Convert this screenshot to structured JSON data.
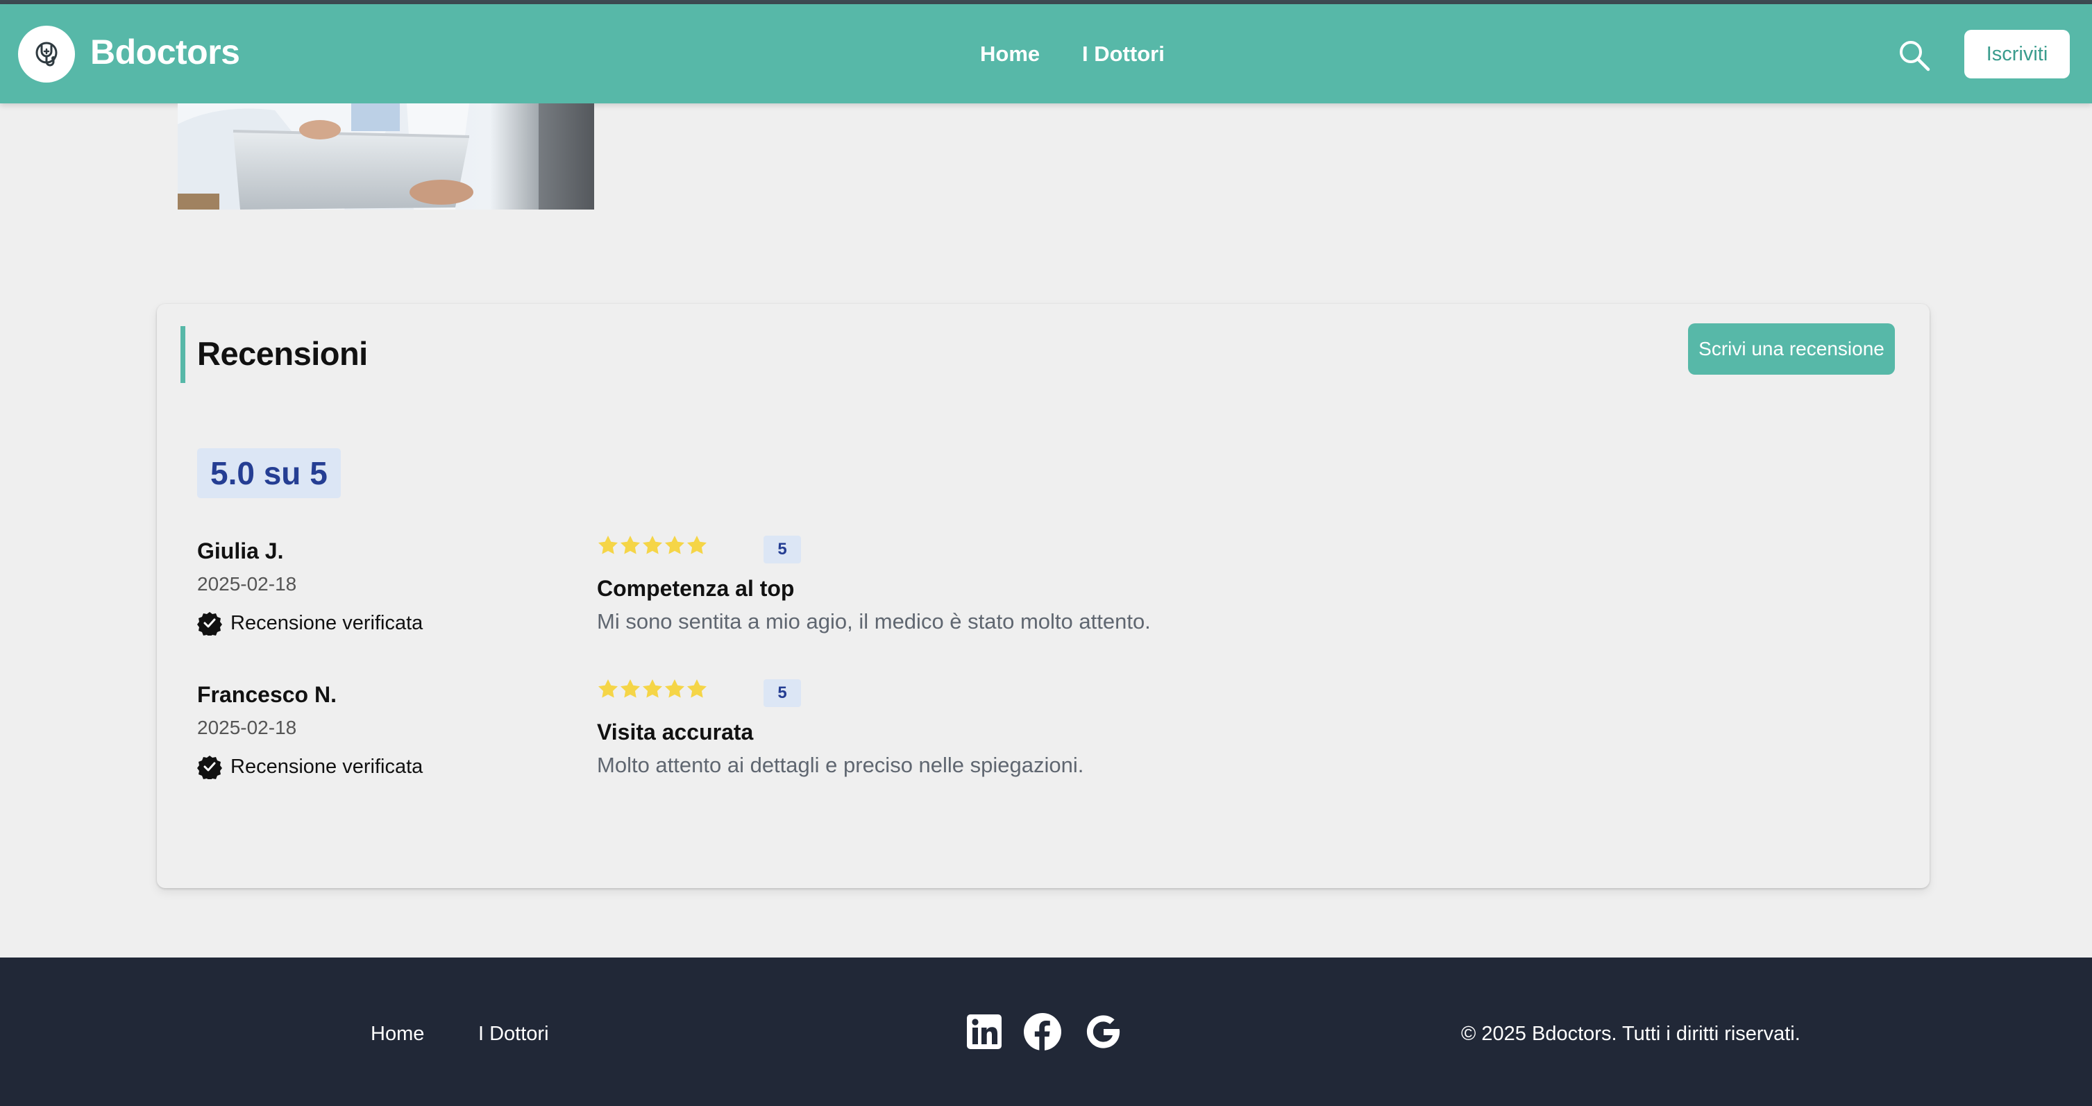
{
  "header": {
    "brand": "Bdoctors",
    "nav": [
      {
        "label": "Home"
      },
      {
        "label": "I Dottori"
      }
    ],
    "signup_label": "Iscriviti"
  },
  "reviews_section": {
    "title": "Recensioni",
    "write_button_label": "Scrivi una recensione",
    "average_label": "5.0 su 5",
    "items": [
      {
        "author": "Giulia J.",
        "date": "2025-02-18",
        "verified_label": "Recensione verificata",
        "rating": 5,
        "rating_label": "5",
        "title": "Competenza al top",
        "body": "Mi sono sentita a mio agio, il medico è stato molto attento."
      },
      {
        "author": "Francesco N.",
        "date": "2025-02-18",
        "verified_label": "Recensione verificata",
        "rating": 5,
        "rating_label": "5",
        "title": "Visita accurata",
        "body": "Molto attento ai dettagli e preciso nelle spiegazioni."
      }
    ]
  },
  "footer": {
    "links": [
      {
        "label": "Home"
      },
      {
        "label": "I Dottori"
      }
    ],
    "social_icons": [
      "linkedin-icon",
      "facebook-icon",
      "google-icon"
    ],
    "copyright": "© 2025 Bdoctors. Tutti i diritti riservati."
  },
  "colors": {
    "primary": "#57b8a8",
    "footer_bg": "#212837",
    "page_bg": "#efefef",
    "badge_bg": "#dce6f5",
    "badge_text": "#253e93",
    "star": "#f5d547"
  }
}
